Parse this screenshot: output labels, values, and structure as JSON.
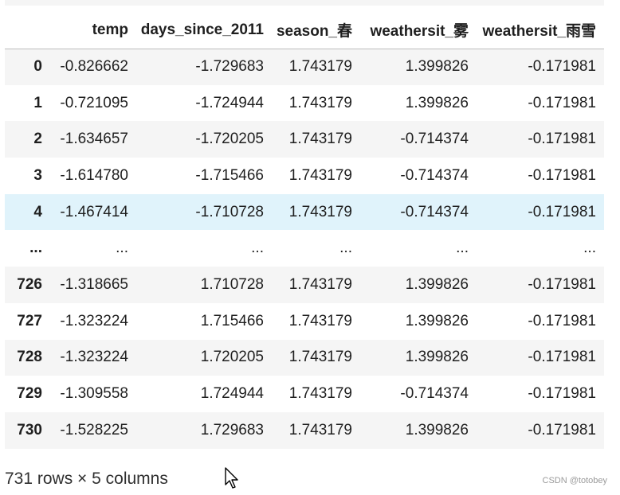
{
  "columns": [
    "",
    "temp",
    "days_since_2011",
    "season_春",
    "weathersit_雾",
    "weathersit_雨雪"
  ],
  "rows": [
    {
      "index": "0",
      "cells": [
        "-0.826662",
        "-1.729683",
        "1.743179",
        "1.399826",
        "-0.171981"
      ]
    },
    {
      "index": "1",
      "cells": [
        "-0.721095",
        "-1.724944",
        "1.743179",
        "1.399826",
        "-0.171981"
      ]
    },
    {
      "index": "2",
      "cells": [
        "-1.634657",
        "-1.720205",
        "1.743179",
        "-0.714374",
        "-0.171981"
      ]
    },
    {
      "index": "3",
      "cells": [
        "-1.614780",
        "-1.715466",
        "1.743179",
        "-0.714374",
        "-0.171981"
      ]
    },
    {
      "index": "4",
      "cells": [
        "-1.467414",
        "-1.710728",
        "1.743179",
        "-0.714374",
        "-0.171981"
      ]
    },
    {
      "index": "...",
      "cells": [
        "...",
        "...",
        "...",
        "...",
        "..."
      ]
    },
    {
      "index": "726",
      "cells": [
        "-1.318665",
        "1.710728",
        "1.743179",
        "1.399826",
        "-0.171981"
      ]
    },
    {
      "index": "727",
      "cells": [
        "-1.323224",
        "1.715466",
        "1.743179",
        "1.399826",
        "-0.171981"
      ]
    },
    {
      "index": "728",
      "cells": [
        "-1.323224",
        "1.720205",
        "1.743179",
        "1.399826",
        "-0.171981"
      ]
    },
    {
      "index": "729",
      "cells": [
        "-1.309558",
        "1.724944",
        "1.743179",
        "-0.714374",
        "-0.171981"
      ]
    },
    {
      "index": "730",
      "cells": [
        "-1.528225",
        "1.729683",
        "1.743179",
        "1.399826",
        "-0.171981"
      ]
    }
  ],
  "summary": "731 rows × 5 columns",
  "watermark": "CSDN @totobey",
  "colors": {
    "row_stripe": "#f5f5f5",
    "row_hover": "#e0f3fb",
    "header_border": "#bdbdbd"
  },
  "icons": {
    "cursor": "mouse-pointer-icon"
  }
}
